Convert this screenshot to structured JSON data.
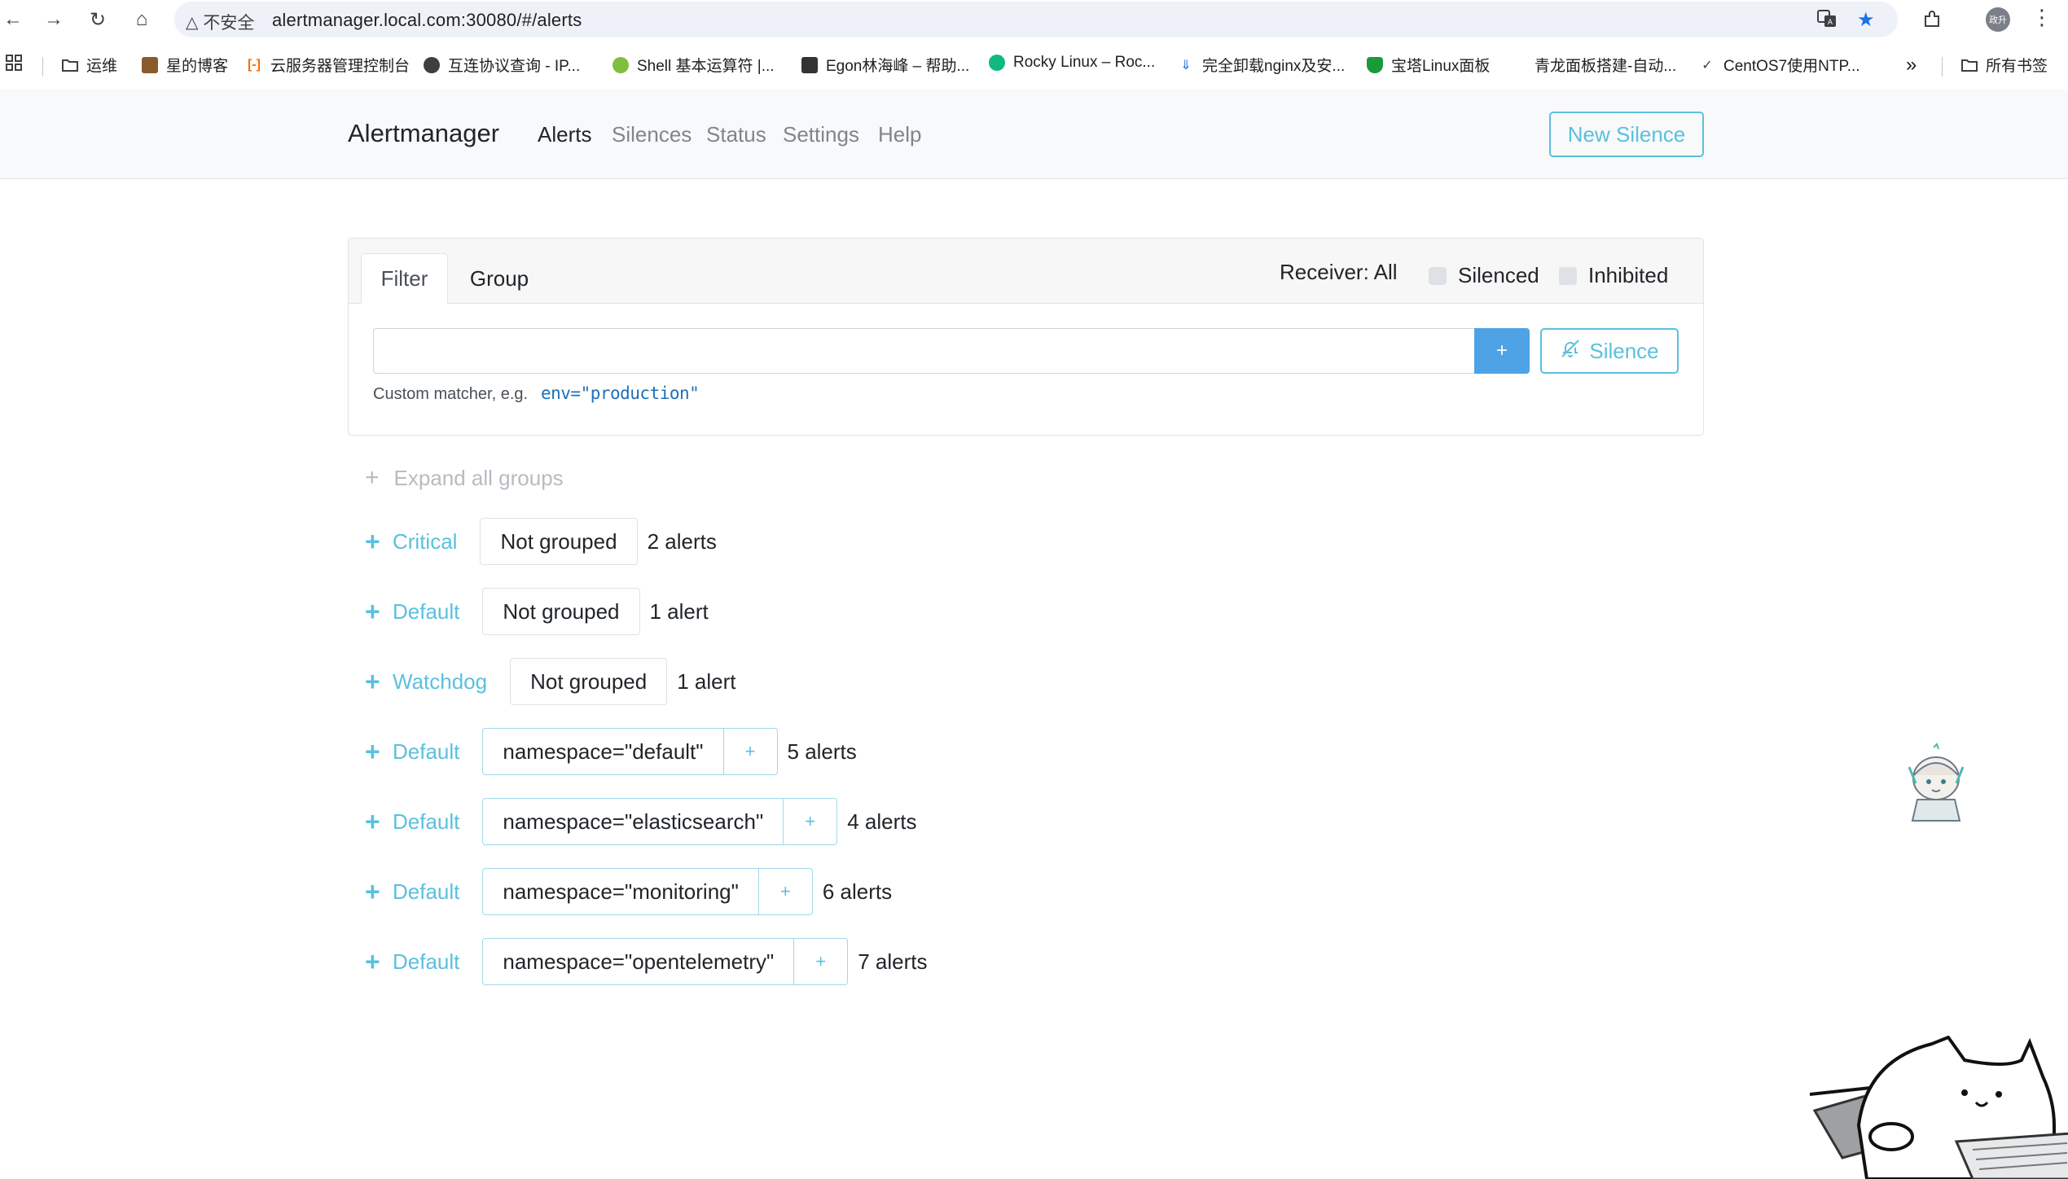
{
  "browser": {
    "security_label": "不安全",
    "url": "alertmanager.local.com:30080/#/alerts",
    "profile_initials": "政升",
    "bookmarks": [
      {
        "label": "运维"
      },
      {
        "label": "星的博客"
      },
      {
        "label": "云服务器管理控制台"
      },
      {
        "label": "互连协议查询 - IP..."
      },
      {
        "label": "Shell 基本运算符 |..."
      },
      {
        "label": "Egon林海峰 – 帮助..."
      },
      {
        "label": "Rocky Linux – Roc..."
      },
      {
        "label": "完全卸载nginx及安..."
      },
      {
        "label": "宝塔Linux面板"
      },
      {
        "label": "青龙面板搭建-自动..."
      },
      {
        "label": "CentOS7使用NTP..."
      }
    ],
    "overflow_label": "»",
    "all_bookmarks": "所有书签"
  },
  "nav": {
    "brand": "Alertmanager",
    "links": [
      "Alerts",
      "Silences",
      "Status",
      "Settings",
      "Help"
    ],
    "active": "Alerts",
    "new_silence": "New Silence"
  },
  "filter_card": {
    "tabs": [
      "Filter",
      "Group"
    ],
    "receiver": "Receiver: All",
    "silenced_label": "Silenced",
    "inhibited_label": "Inhibited",
    "input_value": "",
    "add_label": "+",
    "silence_label": "Silence",
    "hint_prefix": "Custom matcher, e.g.",
    "hint_example": "env=\"production\""
  },
  "groups": {
    "expand_all": "Expand all groups",
    "items": [
      {
        "receiver": "Critical",
        "label": "Not grouped",
        "count": "2 alerts"
      },
      {
        "receiver": "Default",
        "label": "Not grouped",
        "count": "1 alert"
      },
      {
        "receiver": "Watchdog",
        "label": "Not grouped",
        "count": "1 alert"
      },
      {
        "receiver": "Default",
        "label": "namespace=\"default\"",
        "count": "5 alerts"
      },
      {
        "receiver": "Default",
        "label": "namespace=\"elasticsearch\"",
        "count": "4 alerts"
      },
      {
        "receiver": "Default",
        "label": "namespace=\"monitoring\"",
        "count": "6 alerts"
      },
      {
        "receiver": "Default",
        "label": "namespace=\"opentelemetry\"",
        "count": "7 alerts"
      }
    ]
  },
  "colors": {
    "accent_info": "#5bc0de",
    "primary_button": "#4da3e6",
    "link_code": "#1e6fb8"
  }
}
